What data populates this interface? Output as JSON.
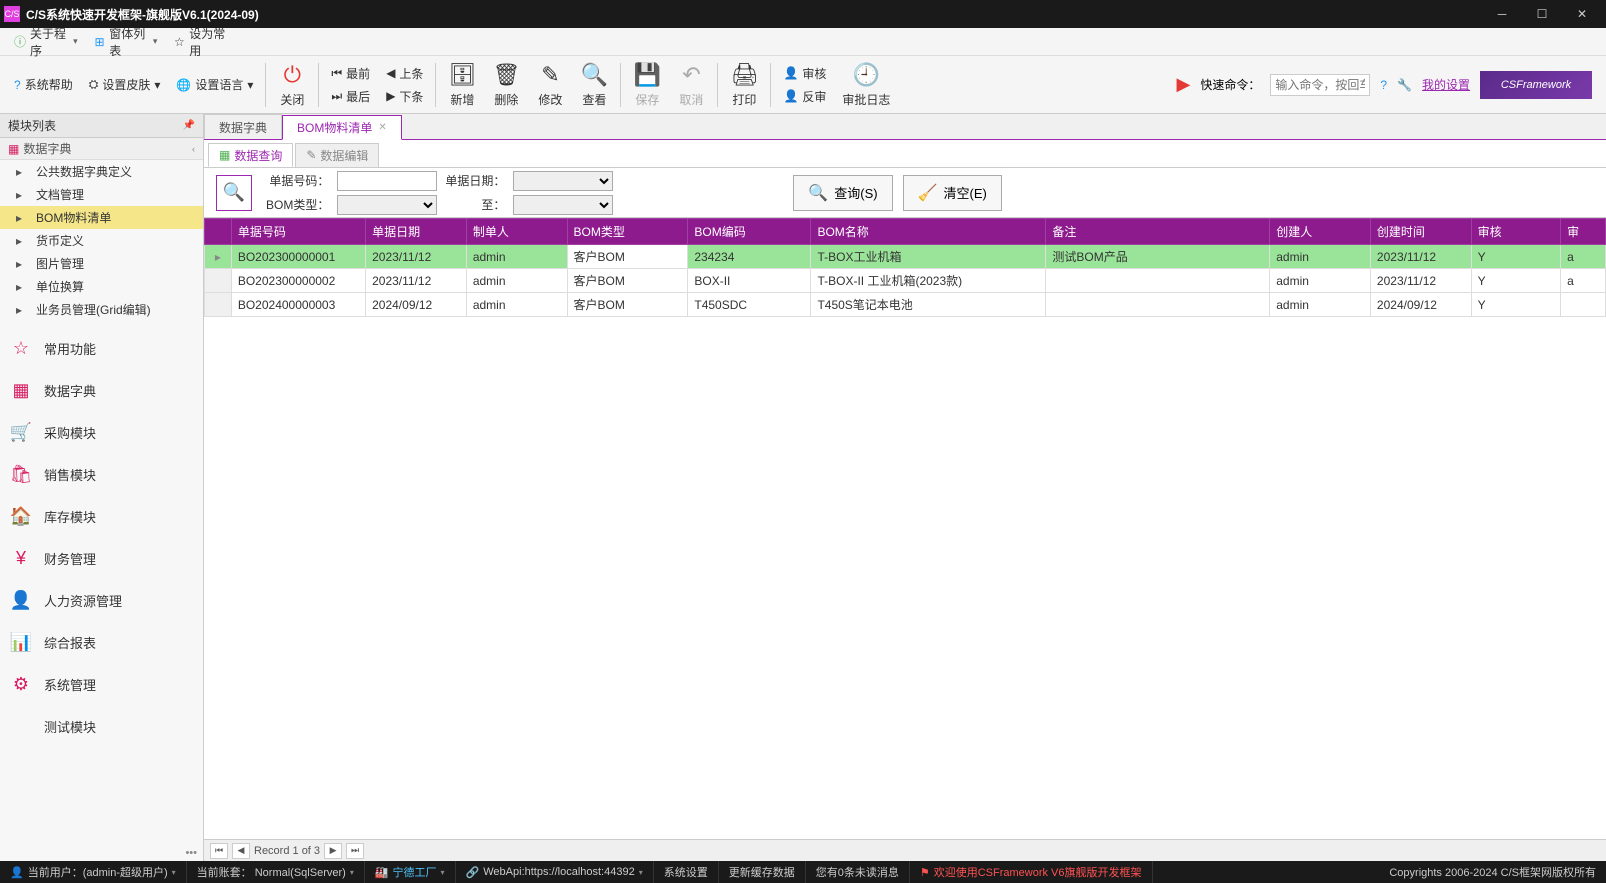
{
  "titlebar": {
    "title": "C/S系统快速开发框架-旗舰版V6.1(2024-09)"
  },
  "menubar": {
    "about": "关于程序",
    "windows": "窗体列表",
    "set_default": "设为常用",
    "help": "系统帮助",
    "skin": "设置皮肤",
    "language": "设置语言"
  },
  "toolbar": {
    "nav_first": "最前",
    "nav_prev": "上条",
    "nav_last": "最后",
    "nav_next": "下条",
    "close": "关闭",
    "add": "新增",
    "delete": "删除",
    "edit": "修改",
    "view": "查看",
    "save": "保存",
    "cancel": "取消",
    "print": "打印",
    "audit": "审核",
    "unaudit": "反审",
    "audit_log": "审批日志",
    "quick_cmd": "快速命令：",
    "quick_cmd_placeholder": "输入命令，按回车",
    "my_settings": "我的设置",
    "logo": "CSFramework"
  },
  "sidebar": {
    "title": "模块列表",
    "section": "数据字典",
    "tree": [
      "公共数据字典定义",
      "文档管理",
      "BOM物料清单",
      "货币定义",
      "图片管理",
      "单位换算",
      "业务员管理(Grid编辑)"
    ],
    "modules": [
      "常用功能",
      "数据字典",
      "采购模块",
      "销售模块",
      "库存模块",
      "财务管理",
      "人力资源管理",
      "综合报表",
      "系统管理",
      "测试模块"
    ]
  },
  "tabs": {
    "tab1": "数据字典",
    "tab2": "BOM物料清单"
  },
  "subtabs": {
    "query": "数据查询",
    "edit": "数据编辑"
  },
  "filters": {
    "doc_no": "单据号码：",
    "doc_date": "单据日期：",
    "bom_type": "BOM类型：",
    "to": "至：",
    "search": "查询(S)",
    "clear": "清空(E)"
  },
  "grid": {
    "cols": [
      "单据号码",
      "单据日期",
      "制单人",
      "BOM类型",
      "BOM编码",
      "BOM名称",
      "备注",
      "创建人",
      "创建时间",
      "审核",
      "审"
    ],
    "rows": [
      {
        "selected": true,
        "arrow": "▸",
        "cells": [
          "BO202300000001",
          "2023/11/12",
          "admin",
          "客户BOM",
          "234234",
          "T-BOX工业机箱",
          "测试BOM产品",
          "admin",
          "2023/11/12",
          "Y",
          "a"
        ]
      },
      {
        "selected": false,
        "cells": [
          "BO202300000002",
          "2023/11/12",
          "admin",
          "客户BOM",
          "BOX-II",
          "T-BOX-II 工业机箱(2023款)",
          "",
          "admin",
          "2023/11/12",
          "Y",
          "a"
        ]
      },
      {
        "selected": false,
        "cells": [
          "BO202400000003",
          "2024/09/12",
          "admin",
          "客户BOM",
          "T450SDC",
          "T450S笔记本电池",
          "",
          "admin",
          "2024/09/12",
          "Y",
          ""
        ]
      }
    ]
  },
  "pager": {
    "text": "Record 1 of 3"
  },
  "statusbar": {
    "user": "当前用户：(admin-超级用户)",
    "account": "当前账套： Normal(SqlServer)",
    "factory": "宁德工厂",
    "webapi": "WebApi:https://localhost:44392",
    "sys_settings": "系统设置",
    "refresh_cache": "更新缓存数据",
    "unread": "您有0条未读消息",
    "welcome": "欢迎使用CSFramework V6旗舰版开发框架",
    "copyright": "Copyrights 2006-2024 C/S框架网版权所有"
  }
}
